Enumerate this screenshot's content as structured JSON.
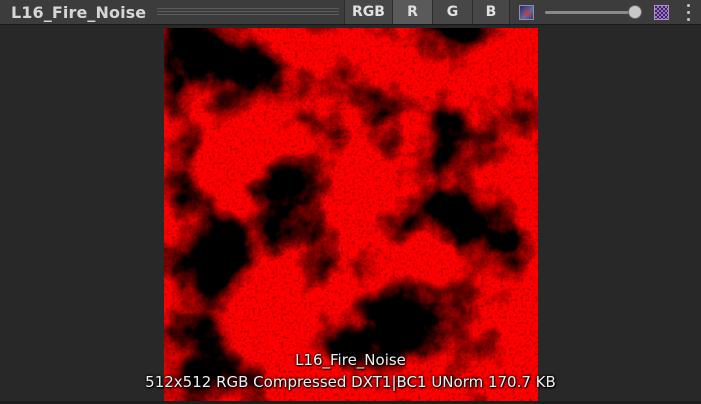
{
  "toolbar": {
    "title": "L16_Fire_Noise",
    "channel_buttons": [
      {
        "label": "RGB",
        "active": false
      },
      {
        "label": "R",
        "active": true
      },
      {
        "label": "G",
        "active": false
      },
      {
        "label": "B",
        "active": false
      }
    ],
    "mip_slider_value": 1.0,
    "icons": {
      "low_mip": "small-mip-icon",
      "high_mip": "large-mip-icon",
      "menu": "kebab-menu-icon"
    }
  },
  "preview": {
    "texture_name": "L16_Fire_Noise",
    "texture_info": "512x512  RGB Compressed DXT1|BC1 UNorm   170.7 KB",
    "display_color": "#ff0000"
  }
}
